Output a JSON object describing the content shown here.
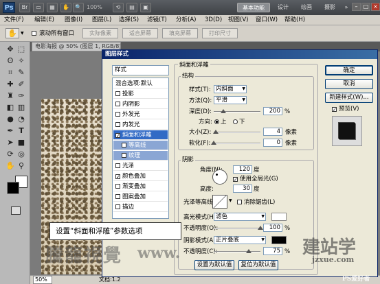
{
  "app": {
    "logo": "Ps",
    "zoom": "100%"
  },
  "workspaces": {
    "basic": "基本功能",
    "design": "设计",
    "paint": "绘画",
    "photo": "摄影",
    "more": "»"
  },
  "window_buttons": {
    "min": "–",
    "max": "□",
    "close": "×"
  },
  "menu": [
    "文件(F)",
    "编辑(E)",
    "图像(I)",
    "图层(L)",
    "选择(S)",
    "滤镜(T)",
    "分析(A)",
    "3D(D)",
    "视图(V)",
    "窗口(W)",
    "帮助(H)"
  ],
  "options": {
    "scroll_all": "滚动所有窗口",
    "actual_pixels": "实际像素",
    "fit_screen": "适合屏幕",
    "fill_screen": "填充屏幕",
    "print_size": "打印尺寸"
  },
  "document": {
    "tab": "电影海报 @ 50% (图层 1, RGB/8)",
    "zoom": "50%",
    "info": "文档:1.2"
  },
  "dialog": {
    "title": "图层样式",
    "styles_header": "样式",
    "blend_options": "混合选项:默认",
    "style_items": [
      {
        "label": "投影",
        "checked": false
      },
      {
        "label": "内阴影",
        "checked": false
      },
      {
        "label": "外发光",
        "checked": false
      },
      {
        "label": "内发光",
        "checked": false
      },
      {
        "label": "斜面和浮雕",
        "checked": true
      },
      {
        "label": "等高线",
        "checked": false
      },
      {
        "label": "纹理",
        "checked": false
      },
      {
        "label": "光泽",
        "checked": false
      },
      {
        "label": "颜色叠加",
        "checked": true
      },
      {
        "label": "渐变叠加",
        "checked": false
      },
      {
        "label": "图案叠加",
        "checked": false
      },
      {
        "label": "描边",
        "checked": false
      }
    ],
    "bevel_title": "斜面和浮雕",
    "structure": {
      "title": "结构",
      "style_label": "样式(T):",
      "style_value": "内斜面",
      "method_label": "方法(Q):",
      "method_value": "平滑",
      "depth_label": "深度(D):",
      "depth_value": "200",
      "depth_level": 0.2,
      "percent": "%",
      "direction_label": "方向:",
      "dir_up": "上",
      "dir_down": "下",
      "size_label": "大小(Z):",
      "size_value": "4",
      "size_level": 0.05,
      "px": "像素",
      "soften_label": "软化(F):",
      "soften_value": "0",
      "soften_level": 0
    },
    "shading": {
      "title": "阴影",
      "angle_label": "角度(N):",
      "angle_value": "120",
      "degree": "度",
      "global_light": "使用全局光(G)",
      "altitude_label": "高度:",
      "altitude_value": "30",
      "gloss_label": "光泽等高线:",
      "anti_alias": "消除锯齿(L)",
      "highlight_mode_label": "高光模式(H):",
      "highlight_mode_value": "滤色",
      "highlight_color": "#ffffff",
      "opacity_label": "不透明度(O):",
      "opacity_value": "100",
      "opacity_level": 1.0,
      "shadow_mode_label": "阴影模式(A):",
      "shadow_mode_value": "正片叠底",
      "shadow_color": "#000000",
      "shadow_opacity_label": "不透明度(C):",
      "shadow_opacity_value": "75",
      "shadow_opacity_level": 0.75
    },
    "buttons": {
      "ok": "确定",
      "cancel": "取消",
      "new_style": "新建样式(W)...",
      "preview": "预览(V)",
      "make_default": "设置为默认值",
      "reset_default": "复位为默认值"
    }
  },
  "callout": "设置“斜面和浮雕”参数选项",
  "watermarks": {
    "left": "騰龍視覺",
    "mid": "www.",
    "right": "建站学",
    "right_url": "jzxue.com",
    "corner": "PS爱好者"
  }
}
